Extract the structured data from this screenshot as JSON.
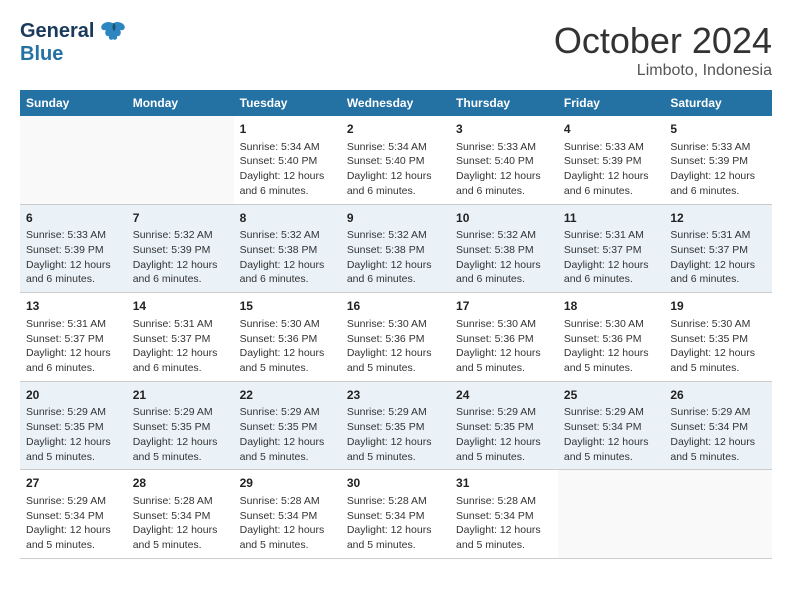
{
  "header": {
    "logo_line1": "General",
    "logo_line2": "Blue",
    "month_title": "October 2024",
    "location": "Limboto, Indonesia"
  },
  "days_of_week": [
    "Sunday",
    "Monday",
    "Tuesday",
    "Wednesday",
    "Thursday",
    "Friday",
    "Saturday"
  ],
  "weeks": [
    {
      "days": [
        {
          "num": "",
          "info": ""
        },
        {
          "num": "",
          "info": ""
        },
        {
          "num": "1",
          "info": "Sunrise: 5:34 AM\nSunset: 5:40 PM\nDaylight: 12 hours and 6 minutes."
        },
        {
          "num": "2",
          "info": "Sunrise: 5:34 AM\nSunset: 5:40 PM\nDaylight: 12 hours and 6 minutes."
        },
        {
          "num": "3",
          "info": "Sunrise: 5:33 AM\nSunset: 5:40 PM\nDaylight: 12 hours and 6 minutes."
        },
        {
          "num": "4",
          "info": "Sunrise: 5:33 AM\nSunset: 5:39 PM\nDaylight: 12 hours and 6 minutes."
        },
        {
          "num": "5",
          "info": "Sunrise: 5:33 AM\nSunset: 5:39 PM\nDaylight: 12 hours and 6 minutes."
        }
      ]
    },
    {
      "days": [
        {
          "num": "6",
          "info": "Sunrise: 5:33 AM\nSunset: 5:39 PM\nDaylight: 12 hours and 6 minutes."
        },
        {
          "num": "7",
          "info": "Sunrise: 5:32 AM\nSunset: 5:39 PM\nDaylight: 12 hours and 6 minutes."
        },
        {
          "num": "8",
          "info": "Sunrise: 5:32 AM\nSunset: 5:38 PM\nDaylight: 12 hours and 6 minutes."
        },
        {
          "num": "9",
          "info": "Sunrise: 5:32 AM\nSunset: 5:38 PM\nDaylight: 12 hours and 6 minutes."
        },
        {
          "num": "10",
          "info": "Sunrise: 5:32 AM\nSunset: 5:38 PM\nDaylight: 12 hours and 6 minutes."
        },
        {
          "num": "11",
          "info": "Sunrise: 5:31 AM\nSunset: 5:37 PM\nDaylight: 12 hours and 6 minutes."
        },
        {
          "num": "12",
          "info": "Sunrise: 5:31 AM\nSunset: 5:37 PM\nDaylight: 12 hours and 6 minutes."
        }
      ]
    },
    {
      "days": [
        {
          "num": "13",
          "info": "Sunrise: 5:31 AM\nSunset: 5:37 PM\nDaylight: 12 hours and 6 minutes."
        },
        {
          "num": "14",
          "info": "Sunrise: 5:31 AM\nSunset: 5:37 PM\nDaylight: 12 hours and 6 minutes."
        },
        {
          "num": "15",
          "info": "Sunrise: 5:30 AM\nSunset: 5:36 PM\nDaylight: 12 hours and 5 minutes."
        },
        {
          "num": "16",
          "info": "Sunrise: 5:30 AM\nSunset: 5:36 PM\nDaylight: 12 hours and 5 minutes."
        },
        {
          "num": "17",
          "info": "Sunrise: 5:30 AM\nSunset: 5:36 PM\nDaylight: 12 hours and 5 minutes."
        },
        {
          "num": "18",
          "info": "Sunrise: 5:30 AM\nSunset: 5:36 PM\nDaylight: 12 hours and 5 minutes."
        },
        {
          "num": "19",
          "info": "Sunrise: 5:30 AM\nSunset: 5:35 PM\nDaylight: 12 hours and 5 minutes."
        }
      ]
    },
    {
      "days": [
        {
          "num": "20",
          "info": "Sunrise: 5:29 AM\nSunset: 5:35 PM\nDaylight: 12 hours and 5 minutes."
        },
        {
          "num": "21",
          "info": "Sunrise: 5:29 AM\nSunset: 5:35 PM\nDaylight: 12 hours and 5 minutes."
        },
        {
          "num": "22",
          "info": "Sunrise: 5:29 AM\nSunset: 5:35 PM\nDaylight: 12 hours and 5 minutes."
        },
        {
          "num": "23",
          "info": "Sunrise: 5:29 AM\nSunset: 5:35 PM\nDaylight: 12 hours and 5 minutes."
        },
        {
          "num": "24",
          "info": "Sunrise: 5:29 AM\nSunset: 5:35 PM\nDaylight: 12 hours and 5 minutes."
        },
        {
          "num": "25",
          "info": "Sunrise: 5:29 AM\nSunset: 5:34 PM\nDaylight: 12 hours and 5 minutes."
        },
        {
          "num": "26",
          "info": "Sunrise: 5:29 AM\nSunset: 5:34 PM\nDaylight: 12 hours and 5 minutes."
        }
      ]
    },
    {
      "days": [
        {
          "num": "27",
          "info": "Sunrise: 5:29 AM\nSunset: 5:34 PM\nDaylight: 12 hours and 5 minutes."
        },
        {
          "num": "28",
          "info": "Sunrise: 5:28 AM\nSunset: 5:34 PM\nDaylight: 12 hours and 5 minutes."
        },
        {
          "num": "29",
          "info": "Sunrise: 5:28 AM\nSunset: 5:34 PM\nDaylight: 12 hours and 5 minutes."
        },
        {
          "num": "30",
          "info": "Sunrise: 5:28 AM\nSunset: 5:34 PM\nDaylight: 12 hours and 5 minutes."
        },
        {
          "num": "31",
          "info": "Sunrise: 5:28 AM\nSunset: 5:34 PM\nDaylight: 12 hours and 5 minutes."
        },
        {
          "num": "",
          "info": ""
        },
        {
          "num": "",
          "info": ""
        }
      ]
    }
  ]
}
